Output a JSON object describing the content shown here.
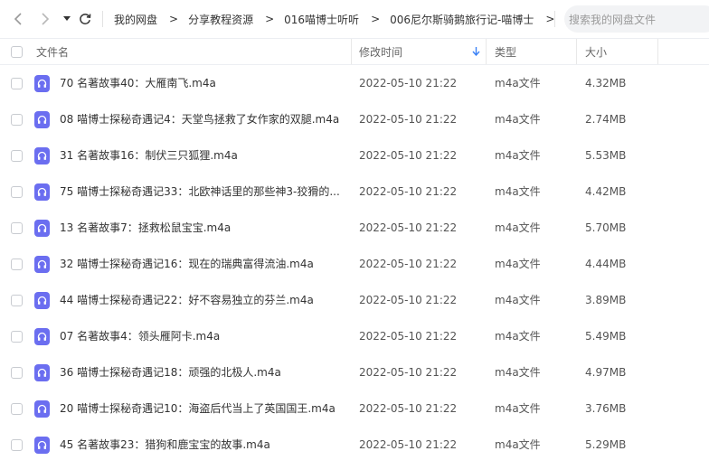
{
  "toolbar": {
    "back_icon": "chevron-left-icon",
    "forward_icon": "chevron-right-icon",
    "dropdown_icon": "caret-down-icon",
    "refresh_icon": "refresh-icon"
  },
  "breadcrumb": {
    "separator": ">",
    "items": [
      "我的网盘",
      "分享教程资源",
      "016喵博士听听",
      "006尼尔斯骑鹅旅行记-喵博士"
    ]
  },
  "search": {
    "placeholder": "搜索我的网盘文件"
  },
  "table": {
    "columns": {
      "name": "文件名",
      "modified": "修改时间",
      "type": "类型",
      "size": "大小"
    },
    "sort": {
      "column": "modified",
      "direction": "descending"
    },
    "file_icon": "audio-file-icon",
    "accent_color": "#6b6ef0",
    "rows": [
      {
        "name": "70 名著故事40：大雁南飞.m4a",
        "modified": "2022-05-10 21:22",
        "type": "m4a文件",
        "size": "4.32MB"
      },
      {
        "name": "08 喵博士探秘奇遇记4：天堂鸟拯救了女作家的双腿.m4a",
        "modified": "2022-05-10 21:22",
        "type": "m4a文件",
        "size": "2.74MB"
      },
      {
        "name": "31 名著故事16：制伏三只狐狸.m4a",
        "modified": "2022-05-10 21:22",
        "type": "m4a文件",
        "size": "5.53MB"
      },
      {
        "name": "75 喵博士探秘奇遇记33：北欧神话里的那些神3-狡猾的...",
        "modified": "2022-05-10 21:22",
        "type": "m4a文件",
        "size": "4.42MB"
      },
      {
        "name": "13 名著故事7：拯救松鼠宝宝.m4a",
        "modified": "2022-05-10 21:22",
        "type": "m4a文件",
        "size": "5.70MB"
      },
      {
        "name": "32 喵博士探秘奇遇记16：现在的瑞典富得流油.m4a",
        "modified": "2022-05-10 21:22",
        "type": "m4a文件",
        "size": "4.44MB"
      },
      {
        "name": "44 喵博士探秘奇遇记22：好不容易独立的芬兰.m4a",
        "modified": "2022-05-10 21:22",
        "type": "m4a文件",
        "size": "3.89MB"
      },
      {
        "name": "07 名著故事4：领头雁阿卡.m4a",
        "modified": "2022-05-10 21:22",
        "type": "m4a文件",
        "size": "5.49MB"
      },
      {
        "name": "36 喵博士探秘奇遇记18：顽强的北极人.m4a",
        "modified": "2022-05-10 21:22",
        "type": "m4a文件",
        "size": "4.97MB"
      },
      {
        "name": "20 喵博士探秘奇遇记10：海盗后代当上了英国国王.m4a",
        "modified": "2022-05-10 21:22",
        "type": "m4a文件",
        "size": "3.76MB"
      },
      {
        "name": "45 名著故事23：猎狗和鹿宝宝的故事.m4a",
        "modified": "2022-05-10 21:22",
        "type": "m4a文件",
        "size": "5.29MB"
      }
    ]
  }
}
